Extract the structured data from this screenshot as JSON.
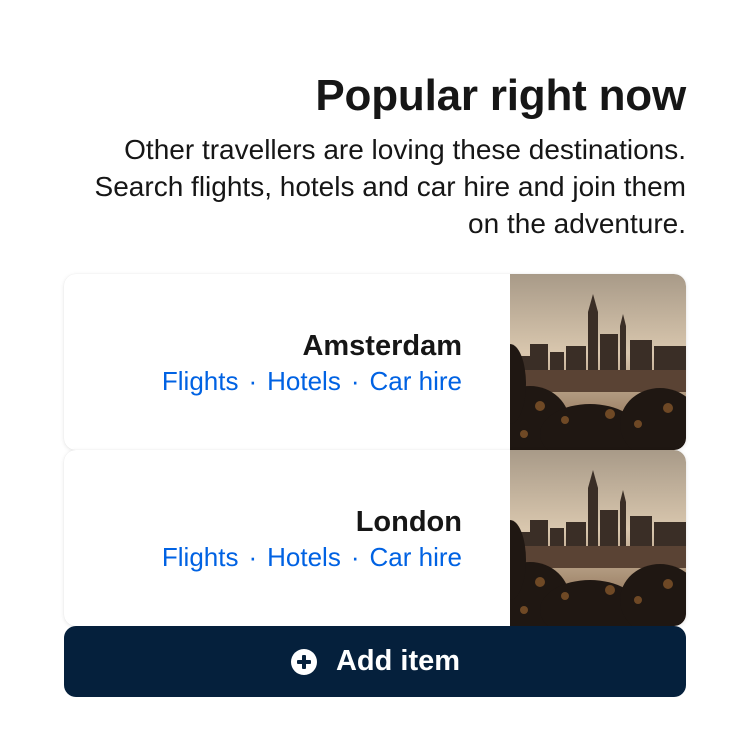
{
  "header": {
    "title": "Popular right now",
    "subtitle": "Other travellers are loving these destinations. Search flights, hotels and car hire and join them on the adventure."
  },
  "destinations": [
    {
      "name": "Amsterdam",
      "links": {
        "flights": "Flights",
        "hotels": "Hotels",
        "car_hire": "Car hire"
      },
      "separator": "·",
      "image_icon": "city-skyline-photo"
    },
    {
      "name": "London",
      "links": {
        "flights": "Flights",
        "hotels": "Hotels",
        "car_hire": "Car hire"
      },
      "separator": "·",
      "image_icon": "city-skyline-photo"
    }
  ],
  "add_button": {
    "label": "Add item",
    "icon": "plus-circle-icon"
  },
  "colors": {
    "link": "#0062e3",
    "button_bg": "#05203c",
    "text": "#161616"
  }
}
